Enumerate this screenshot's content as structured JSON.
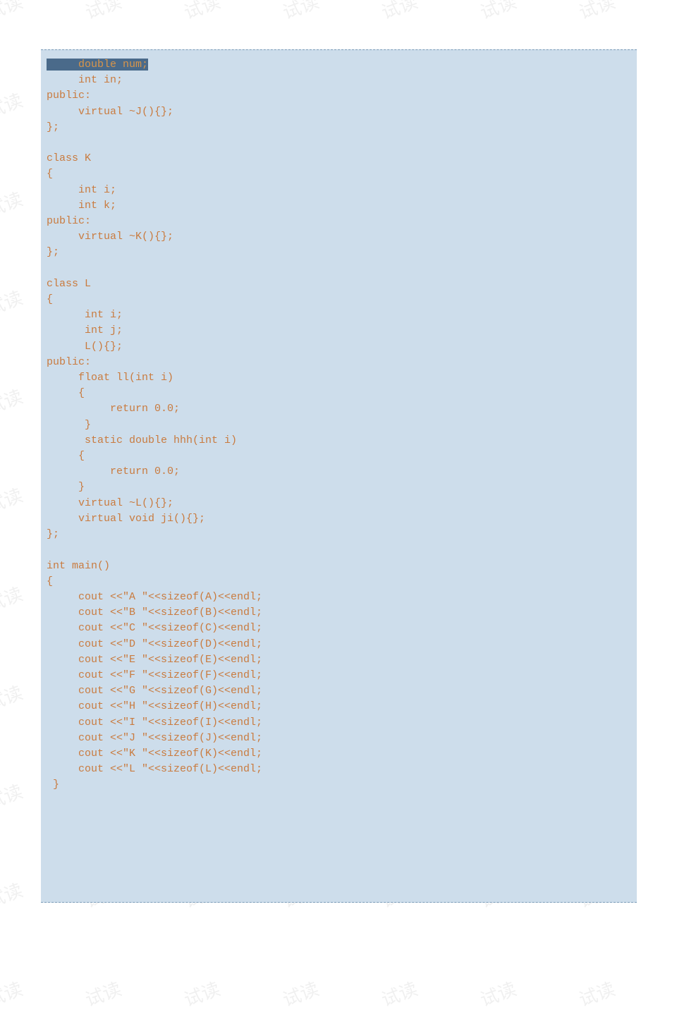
{
  "watermark_text": "试读",
  "code": {
    "lines": [
      {
        "indent": "     ",
        "text": "double num;",
        "highlight": true
      },
      {
        "indent": "     ",
        "text": "int in;"
      },
      {
        "indent": "",
        "text": "public:"
      },
      {
        "indent": "     ",
        "text": "virtual ~J(){};"
      },
      {
        "indent": "",
        "text": "};"
      },
      {
        "indent": "",
        "text": ""
      },
      {
        "indent": "",
        "text": "class K"
      },
      {
        "indent": "",
        "text": "{"
      },
      {
        "indent": "     ",
        "text": "int i;"
      },
      {
        "indent": "     ",
        "text": "int k;"
      },
      {
        "indent": "",
        "text": "public:"
      },
      {
        "indent": "     ",
        "text": "virtual ~K(){};"
      },
      {
        "indent": "",
        "text": "};"
      },
      {
        "indent": "",
        "text": ""
      },
      {
        "indent": "",
        "text": "class L"
      },
      {
        "indent": "",
        "text": "{"
      },
      {
        "indent": "      ",
        "text": "int i;"
      },
      {
        "indent": "      ",
        "text": "int j;"
      },
      {
        "indent": "      ",
        "text": "L(){};"
      },
      {
        "indent": "",
        "text": "public:"
      },
      {
        "indent": "     ",
        "text": "float ll(int i)"
      },
      {
        "indent": "     ",
        "text": "{"
      },
      {
        "indent": "          ",
        "text": "return 0.0;"
      },
      {
        "indent": "      ",
        "text": "}"
      },
      {
        "indent": "      ",
        "text": "static double hhh(int i)"
      },
      {
        "indent": "     ",
        "text": "{"
      },
      {
        "indent": "          ",
        "text": "return 0.0;"
      },
      {
        "indent": "     ",
        "text": "}"
      },
      {
        "indent": "     ",
        "text": "virtual ~L(){};"
      },
      {
        "indent": "     ",
        "text": "virtual void ji(){};"
      },
      {
        "indent": "",
        "text": "};"
      },
      {
        "indent": "",
        "text": ""
      },
      {
        "indent": "",
        "text": "int main()"
      },
      {
        "indent": "",
        "text": "{"
      },
      {
        "indent": "     ",
        "text": "cout <<\"A \"<<sizeof(A)<<endl;"
      },
      {
        "indent": "     ",
        "text": "cout <<\"B \"<<sizeof(B)<<endl;"
      },
      {
        "indent": "     ",
        "text": "cout <<\"C \"<<sizeof(C)<<endl;"
      },
      {
        "indent": "     ",
        "text": "cout <<\"D \"<<sizeof(D)<<endl;"
      },
      {
        "indent": "     ",
        "text": "cout <<\"E \"<<sizeof(E)<<endl;"
      },
      {
        "indent": "     ",
        "text": "cout <<\"F \"<<sizeof(F)<<endl;"
      },
      {
        "indent": "     ",
        "text": "cout <<\"G \"<<sizeof(G)<<endl;"
      },
      {
        "indent": "     ",
        "text": "cout <<\"H \"<<sizeof(H)<<endl;"
      },
      {
        "indent": "     ",
        "text": "cout <<\"I \"<<sizeof(I)<<endl;"
      },
      {
        "indent": "     ",
        "text": "cout <<\"J \"<<sizeof(J)<<endl;"
      },
      {
        "indent": "     ",
        "text": "cout <<\"K \"<<sizeof(K)<<endl;"
      },
      {
        "indent": "     ",
        "text": "cout <<\"L \"<<sizeof(L)<<endl;"
      },
      {
        "indent": " ",
        "text": "}"
      }
    ]
  }
}
